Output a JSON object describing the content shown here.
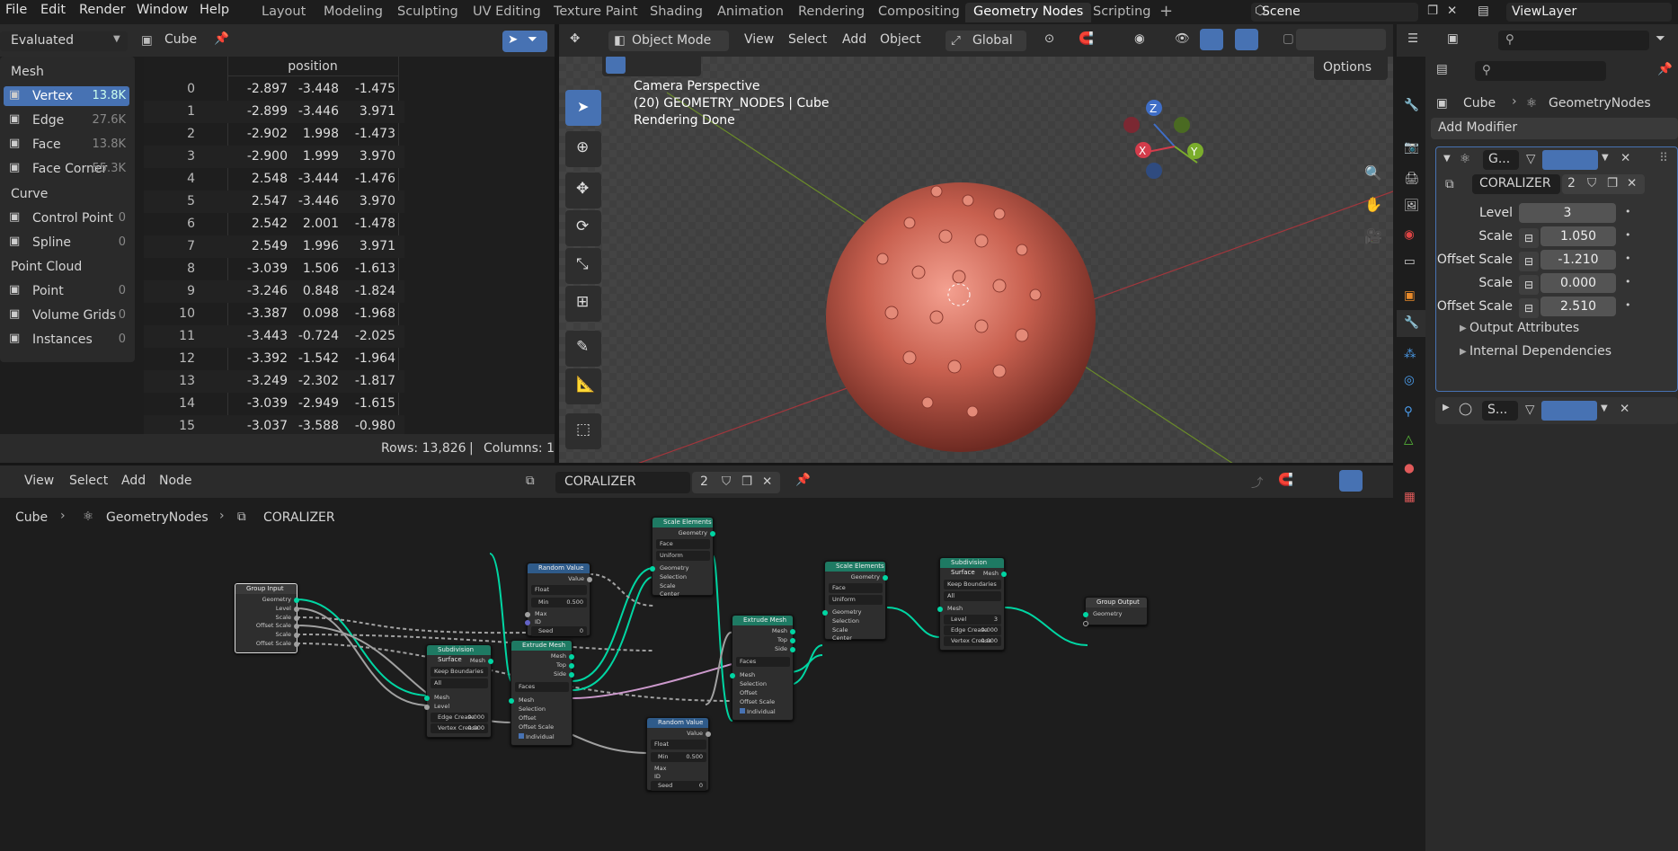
{
  "menubar": {
    "items": [
      "File",
      "Edit",
      "Render",
      "Window",
      "Help"
    ],
    "workspaces": [
      "Layout",
      "Modeling",
      "Sculpting",
      "UV Editing",
      "Texture Paint",
      "Shading",
      "Animation",
      "Rendering",
      "Compositing",
      "Geometry Nodes",
      "Scripting"
    ],
    "active_workspace": "Geometry Nodes",
    "scene": "Scene",
    "view_layer": "ViewLayer"
  },
  "spreadsheet": {
    "mode": "Evaluated",
    "object": "Cube",
    "column_header": "position",
    "categories": [
      {
        "label": "Mesh",
        "count": "",
        "header": true
      },
      {
        "label": "Vertex",
        "count": "13.8K",
        "active": true
      },
      {
        "label": "Edge",
        "count": "27.6K"
      },
      {
        "label": "Face",
        "count": "13.8K"
      },
      {
        "label": "Face Corner",
        "count": "55.3K"
      },
      {
        "label": "Curve",
        "count": "",
        "header": true
      },
      {
        "label": "Control Point",
        "count": "0"
      },
      {
        "label": "Spline",
        "count": "0"
      },
      {
        "label": "Point Cloud",
        "count": "",
        "header": true
      },
      {
        "label": "Point",
        "count": "0"
      },
      {
        "label": "Volume Grids",
        "count": "0"
      },
      {
        "label": "Instances",
        "count": "0"
      }
    ],
    "rows": [
      [
        "0",
        "-2.897",
        "-3.448",
        "-1.475"
      ],
      [
        "1",
        "-2.899",
        "-3.446",
        "3.971"
      ],
      [
        "2",
        "-2.902",
        "1.998",
        "-1.473"
      ],
      [
        "3",
        "-2.900",
        "1.999",
        "3.970"
      ],
      [
        "4",
        "2.548",
        "-3.444",
        "-1.476"
      ],
      [
        "5",
        "2.547",
        "-3.446",
        "3.970"
      ],
      [
        "6",
        "2.542",
        "2.001",
        "-1.478"
      ],
      [
        "7",
        "2.549",
        "1.996",
        "3.971"
      ],
      [
        "8",
        "-3.039",
        "1.506",
        "-1.613"
      ],
      [
        "9",
        "-3.246",
        "0.848",
        "-1.824"
      ],
      [
        "10",
        "-3.387",
        "0.098",
        "-1.968"
      ],
      [
        "11",
        "-3.443",
        "-0.724",
        "-2.025"
      ],
      [
        "12",
        "-3.392",
        "-1.542",
        "-1.964"
      ],
      [
        "13",
        "-3.249",
        "-2.302",
        "-1.817"
      ],
      [
        "14",
        "-3.039",
        "-2.949",
        "-1.615"
      ],
      [
        "15",
        "-3.037",
        "-3.588",
        "-0.980"
      ]
    ],
    "footer_rows": "Rows: 13,826",
    "footer_sep": "|",
    "footer_cols": "Columns: 1"
  },
  "viewport": {
    "mode": "Object Mode",
    "menus": [
      "View",
      "Select",
      "Add",
      "Object"
    ],
    "orientation": "Global",
    "options": "Options",
    "overlay_lines": [
      "Camera Perspective",
      "(20) GEOMETRY_NODES | Cube",
      "Rendering Done"
    ],
    "gizmo_axes": {
      "x": "X",
      "y": "Y",
      "z": "Z"
    }
  },
  "node_editor": {
    "menus": [
      "View",
      "Select",
      "Add",
      "Node"
    ],
    "tree_name": "CORALIZER",
    "users": "2",
    "breadcrumb": [
      "Cube",
      "GeometryNodes",
      "CORALIZER"
    ],
    "nodes": {
      "group_input": {
        "title": "Group Input",
        "outputs": [
          "Geometry",
          "Level",
          "Scale",
          "Offset Scale",
          "Scale",
          "Offset Scale"
        ]
      },
      "subdiv1": {
        "title": "Subdivision Surface",
        "out": "Mesh",
        "opt1": "Keep Boundaries",
        "opt2": "All",
        "in1": "Mesh",
        "in2": "Level",
        "edge": "Edge Crease",
        "edge_v": "0.000",
        "vert": "Vertex Crease",
        "vert_v": "0.000"
      },
      "random1": {
        "title": "Random Value",
        "out": "Value",
        "type": "Float",
        "min": "Min",
        "min_v": "0.500",
        "max": "Max",
        "id": "ID",
        "seed": "Seed",
        "seed_v": "0"
      },
      "extrude1": {
        "title": "Extrude Mesh",
        "outs": [
          "Mesh",
          "Top",
          "Side"
        ],
        "mode": "Faces",
        "ins": [
          "Mesh",
          "Selection",
          "Offset",
          "Offset Scale"
        ],
        "individual": "Individual"
      },
      "scale1": {
        "title": "Scale Elements",
        "out": "Geometry",
        "d1": "Face",
        "d2": "Uniform",
        "ins": [
          "Geometry",
          "Selection",
          "Scale",
          "Center"
        ]
      },
      "random2": {
        "title": "Random Value",
        "out": "Value",
        "type": "Float",
        "min": "Min",
        "min_v": "0.500",
        "max": "Max",
        "id": "ID",
        "seed": "Seed",
        "seed_v": "0"
      },
      "extrude2": {
        "title": "Extrude Mesh",
        "outs": [
          "Mesh",
          "Top",
          "Side"
        ],
        "mode": "Faces",
        "ins": [
          "Mesh",
          "Selection",
          "Offset",
          "Offset Scale"
        ],
        "individual": "Individual"
      },
      "scale2": {
        "title": "Scale Elements",
        "out": "Geometry",
        "d1": "Face",
        "d2": "Uniform",
        "ins": [
          "Geometry",
          "Selection",
          "Scale",
          "Center"
        ]
      },
      "subdiv2": {
        "title": "Subdivision Surface",
        "out": "Mesh",
        "opt1": "Keep Boundaries",
        "opt2": "All",
        "in1": "Mesh",
        "level": "Level",
        "level_v": "3",
        "edge": "Edge Crease",
        "edge_v": "0.000",
        "vert": "Vertex Crease",
        "vert_v": "0.000"
      },
      "group_output": {
        "title": "Group Output",
        "in": "Geometry"
      }
    }
  },
  "properties": {
    "breadcrumb_obj": "Cube",
    "breadcrumb_mod": "GeometryNodes",
    "add_modifier": "Add Modifier",
    "modifier_short": "G...",
    "node_group": "CORALIZER",
    "node_group_users": "2",
    "inputs": [
      {
        "label": "Level",
        "value": "3"
      },
      {
        "label": "Scale",
        "value": "1.050"
      },
      {
        "label": "Offset Scale",
        "value": "-1.210"
      },
      {
        "label": "Scale",
        "value": "0.000"
      },
      {
        "label": "Offset Scale",
        "value": "2.510"
      }
    ],
    "output_attributes": "Output Attributes",
    "internal_dependencies": "Internal Dependencies",
    "second_modifier": "S..."
  },
  "colors": {
    "accent": "#4772b3",
    "node_geo": "#00d6a3",
    "header_green": "#1e7a63",
    "header_blue": "#2f5b8a"
  }
}
